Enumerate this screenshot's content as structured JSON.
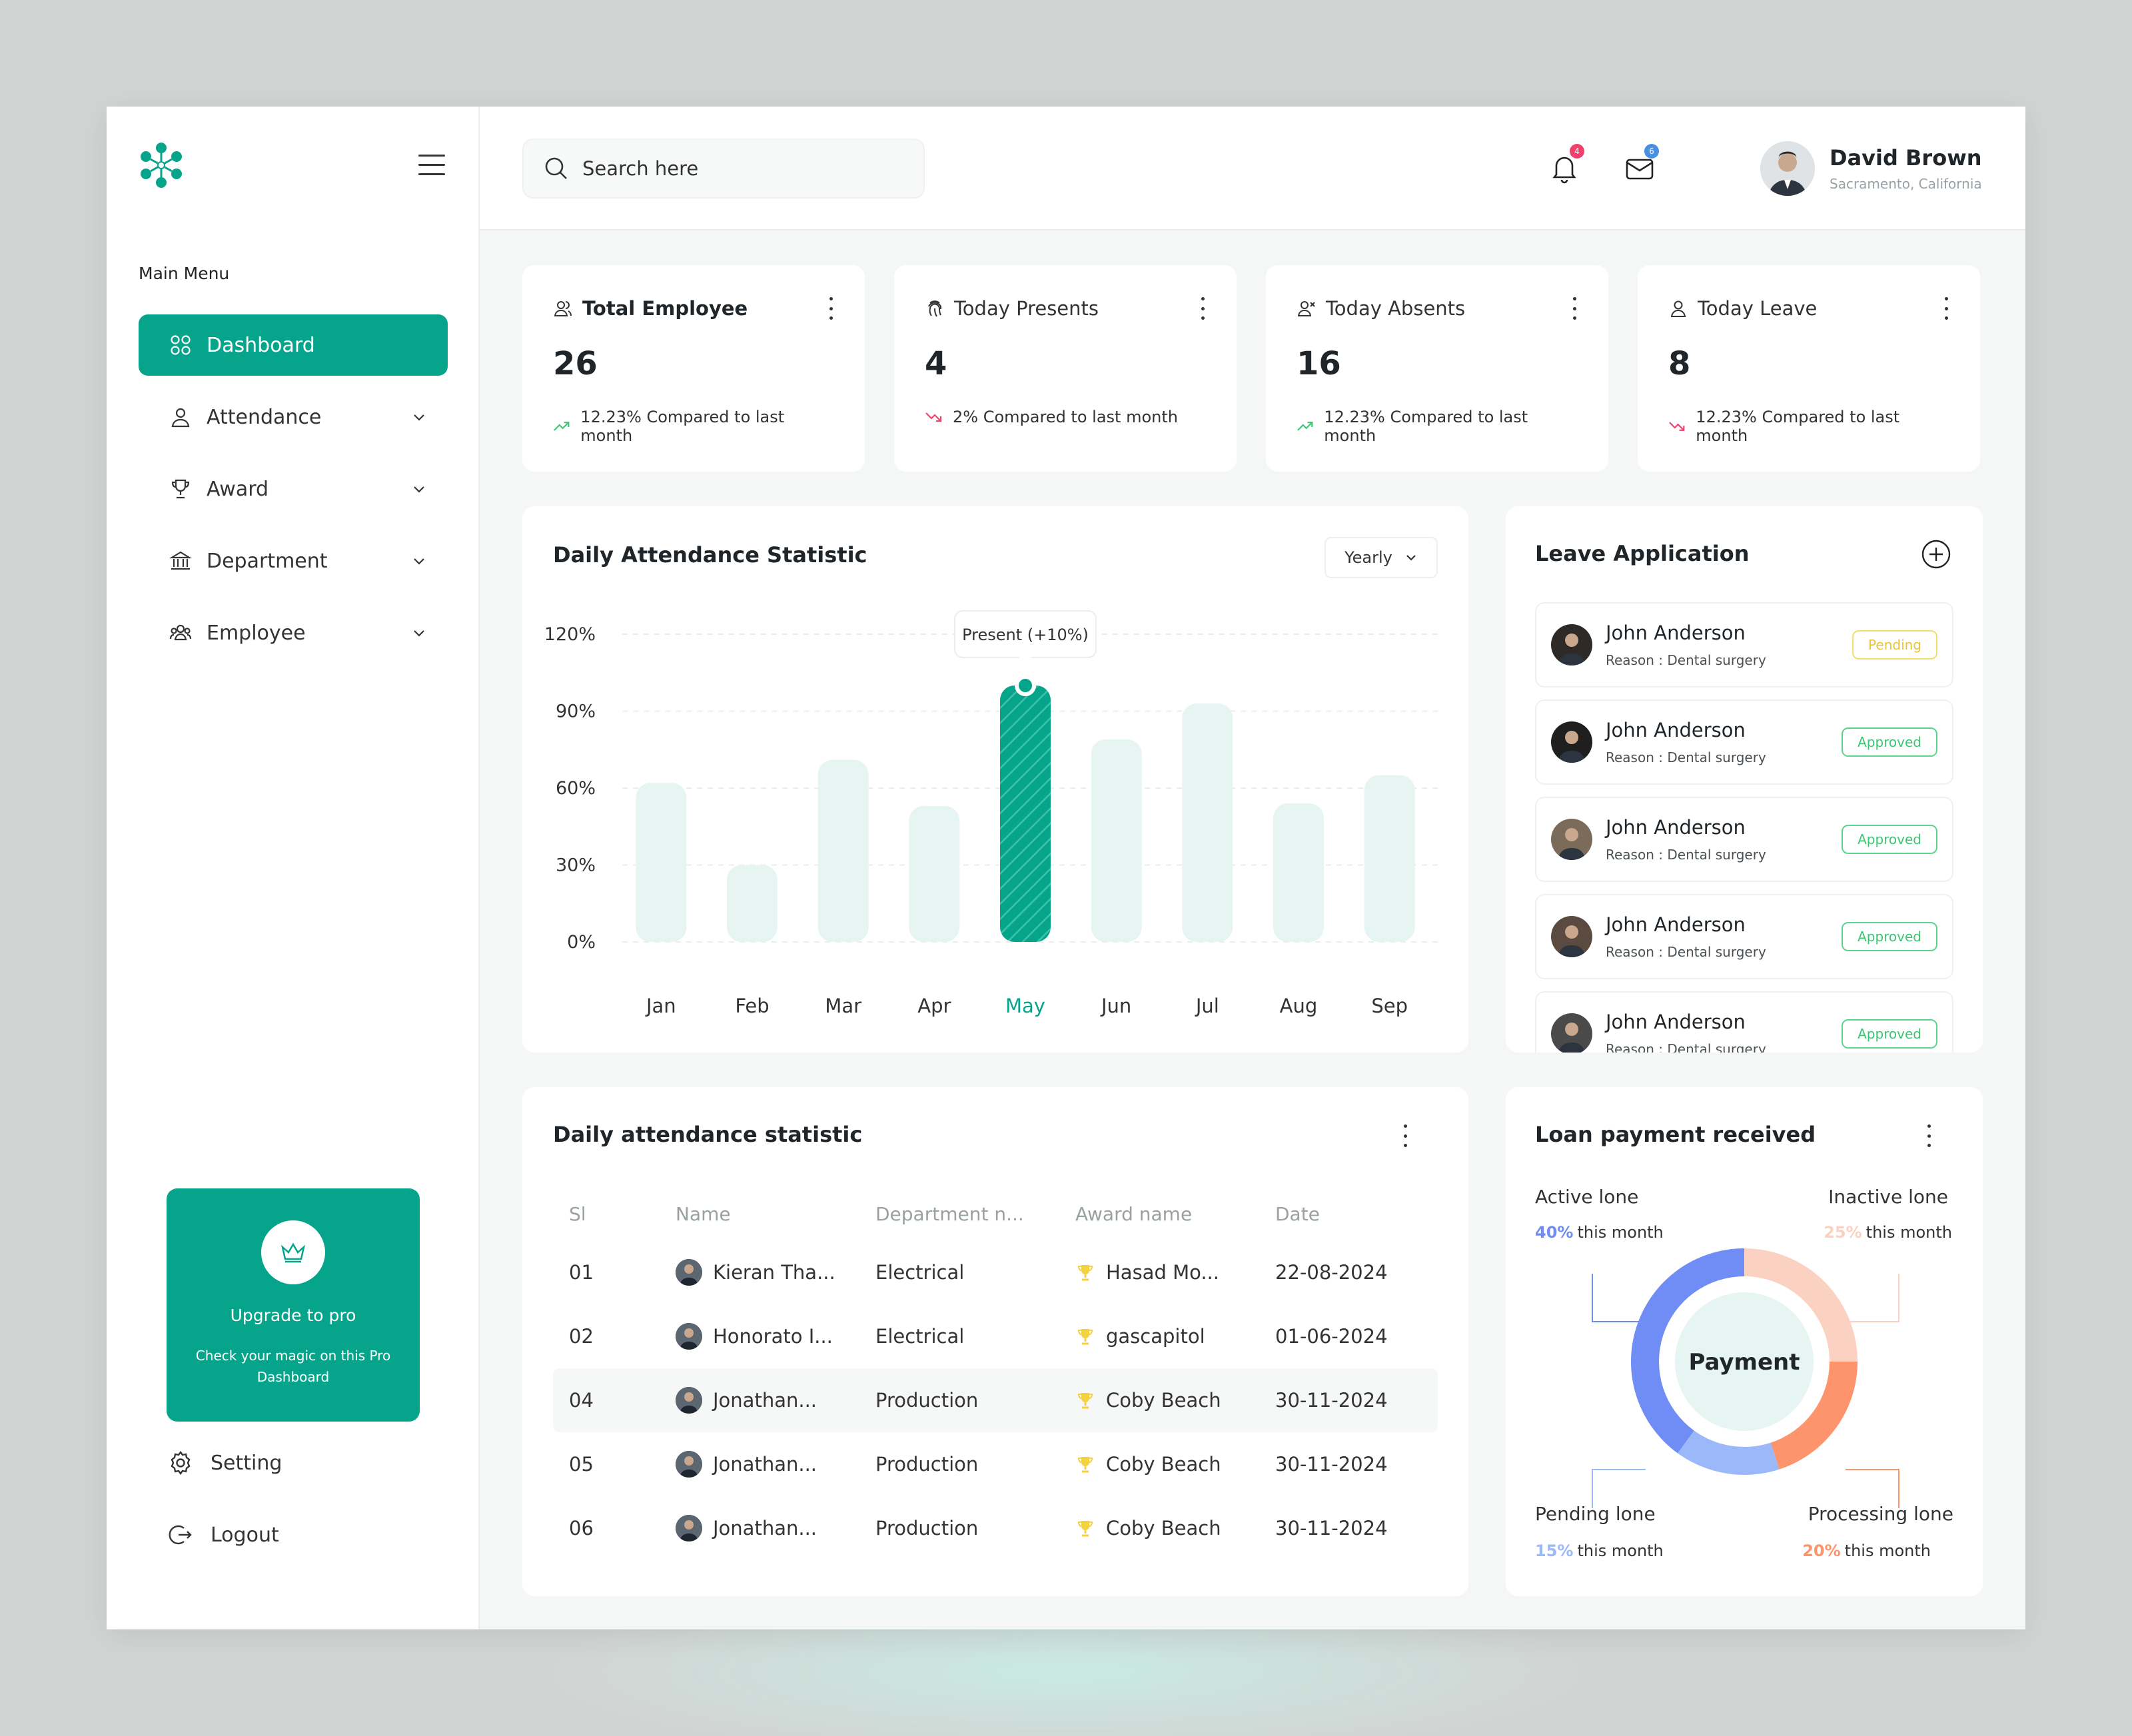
{
  "sidebar": {
    "main_menu_label": "Main Menu",
    "items": [
      {
        "label": "Dashboard",
        "active": true
      },
      {
        "label": "Attendance"
      },
      {
        "label": "Award"
      },
      {
        "label": "Department"
      },
      {
        "label": "Employee"
      }
    ],
    "upgrade": {
      "title": "Upgrade to pro",
      "text": "Check your magic on this Pro Dashboard"
    },
    "bottom": [
      {
        "label": "Setting"
      },
      {
        "label": "Logout"
      }
    ]
  },
  "topbar": {
    "search_placeholder": "Search here",
    "notifications_count": "4",
    "messages_count": "6",
    "user": {
      "name": "David Brown",
      "location": "Sacramento, California"
    }
  },
  "stats": [
    {
      "title": "Total Employee",
      "value": "26",
      "change": "12.23% Compared to last month",
      "trend": "up"
    },
    {
      "title": "Today Presents",
      "value": "4",
      "change": "2% Compared to last month",
      "trend": "down"
    },
    {
      "title": "Today Absents",
      "value": "16",
      "change": "12.23% Compared to last month",
      "trend": "up"
    },
    {
      "title": "Today Leave",
      "value": "8",
      "change": "12.23% Compared to last month",
      "trend": "down"
    }
  ],
  "chart_data": {
    "type": "bar",
    "title": "Daily Attendance Statistic",
    "period": "Yearly",
    "categories": [
      "Jan",
      "Feb",
      "Mar",
      "Apr",
      "May",
      "Jun",
      "Jul",
      "Aug",
      "Sep"
    ],
    "values": [
      62,
      30,
      71,
      53,
      100,
      79,
      93,
      54,
      65
    ],
    "yticks": [
      "0%",
      "30%",
      "60%",
      "90%",
      "120%"
    ],
    "ylim": [
      0,
      120
    ],
    "highlight_index": 4,
    "tooltip": "Present (+10%)",
    "colors": {
      "bar": "#e7f5f2",
      "highlight": "#06a58b"
    }
  },
  "leave": {
    "title": "Leave Application",
    "items": [
      {
        "name": "John Anderson",
        "reason_label": "Reason :",
        "reason": "Dental surgery",
        "status": "Pending",
        "status_type": "pending"
      },
      {
        "name": "John Anderson",
        "reason_label": "Reason :",
        "reason": "Dental surgery",
        "status": "Approved",
        "status_type": "approved"
      },
      {
        "name": "John Anderson",
        "reason_label": "Reason :",
        "reason": "Dental surgery",
        "status": "Approved",
        "status_type": "approved"
      },
      {
        "name": "John Anderson",
        "reason_label": "Reason :",
        "reason": "Dental surgery",
        "status": "Approved",
        "status_type": "approved"
      },
      {
        "name": "John Anderson",
        "reason_label": "Reason :",
        "reason": "Dental surgery",
        "status": "Approved",
        "status_type": "approved"
      }
    ]
  },
  "table": {
    "title": "Daily attendance statistic",
    "headers": [
      "Sl",
      "Name",
      "Department n...",
      "Award name",
      "Date"
    ],
    "rows": [
      {
        "sl": "01",
        "name": "Kieran Tha...",
        "department": "Electrical",
        "award": "Hasad Mo...",
        "date": "22-08-2024"
      },
      {
        "sl": "02",
        "name": "Honorato I...",
        "department": "Electrical",
        "award": "gascapitol",
        "date": "01-06-2024"
      },
      {
        "sl": "04",
        "name": "Jonathan...",
        "department": "Production",
        "award": "Coby Beach",
        "date": "30-11-2024",
        "highlight": true
      },
      {
        "sl": "05",
        "name": "Jonathan...",
        "department": "Production",
        "award": "Coby Beach",
        "date": "30-11-2024"
      },
      {
        "sl": "06",
        "name": "Jonathan...",
        "department": "Production",
        "award": "Coby Beach",
        "date": "30-11-2024"
      }
    ]
  },
  "loan": {
    "title": "Loan payment received",
    "center_label": "Payment",
    "segments": [
      {
        "label": "Active lone",
        "percent": "40%",
        "suffix": "this month",
        "color": "#6f8df5"
      },
      {
        "label": "Inactive lone",
        "percent": "25%",
        "suffix": "this month",
        "color": "#fbd2c1"
      },
      {
        "label": "Pending lone",
        "percent": "15%",
        "suffix": "this month",
        "color": "#9bb8fb"
      },
      {
        "label": "Processing lone",
        "percent": "20%",
        "suffix": "this month",
        "color": "#fd946c"
      }
    ]
  }
}
